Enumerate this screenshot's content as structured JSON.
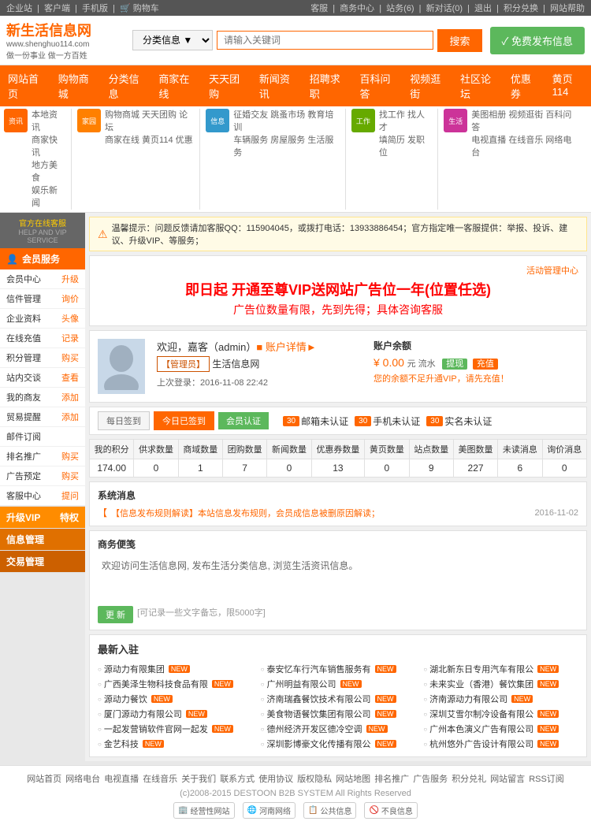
{
  "topbar": {
    "left_links": [
      "企业站",
      "客户端",
      "手机版",
      "购物车"
    ],
    "right_links": [
      "客服",
      "商务中心",
      "站务(6)",
      "新对话(0)",
      "退出",
      "积分兑换",
      "网站帮助"
    ]
  },
  "header": {
    "logo_name": "新生活信息网",
    "logo_url": "www.shenghuo114.com",
    "logo_slogan": "做一份事业 做一方百姓",
    "search_placeholder": "请输入关键词",
    "search_category": "分类信息",
    "search_btn": "搜索",
    "publish_btn": "✓ 免费发布信息"
  },
  "main_nav": {
    "items": [
      {
        "label": "网站首页",
        "active": false
      },
      {
        "label": "购物商城",
        "active": false
      },
      {
        "label": "分类信息",
        "active": false
      },
      {
        "label": "商家在线",
        "active": false
      },
      {
        "label": "天天团购",
        "active": false
      },
      {
        "label": "新闻资讯",
        "active": false
      },
      {
        "label": "招聘求职",
        "active": false
      },
      {
        "label": "百科问答",
        "active": false
      },
      {
        "label": "视频逛街",
        "active": false
      },
      {
        "label": "社区论坛",
        "active": false
      },
      {
        "label": "优惠券",
        "active": false
      },
      {
        "label": "黄页114",
        "active": false
      }
    ]
  },
  "sub_nav": {
    "sections": [
      {
        "icon": "资讯",
        "color": "#ff6600",
        "links": [
          "本地资讯",
          "商家快讯",
          "地方美食",
          "娱乐新闻"
        ]
      },
      {
        "icon": "家园",
        "color": "#ff8000",
        "links": [
          "购物商城",
          "天天团购",
          "论坛",
          "商家在线",
          "黄页114",
          "优惠"
        ]
      },
      {
        "icon": "信息",
        "color": "#3399cc",
        "links": [
          "征婚交友",
          "跳蚤市场",
          "教育培训",
          "车辆服务",
          "房屋服务",
          "生活服务"
        ]
      },
      {
        "icon": "工作",
        "color": "#66aa00",
        "links": [
          "找工作",
          "找人才",
          "填简历",
          "发职位"
        ]
      },
      {
        "icon": "生活",
        "color": "#cc3399",
        "links": [
          "美图相册",
          "视频逛街",
          "百科问答",
          "电视直播",
          "在线音乐",
          "网络电台"
        ]
      }
    ]
  },
  "sidebar": {
    "customer_service": {
      "title": "官方在线客服",
      "sub": "HELP AND VIP SERVICE"
    },
    "member_section": {
      "title": "会员服务"
    },
    "items": [
      {
        "left": "会员中心",
        "right": "升级"
      },
      {
        "left": "信件管理",
        "right": "询价"
      },
      {
        "left": "企业资料",
        "right": "头像"
      },
      {
        "left": "在线充值",
        "right": "记录"
      },
      {
        "left": "积分管理",
        "right": "购买"
      },
      {
        "left": "站内交谈",
        "right": "查看"
      },
      {
        "left": "我的商友",
        "right": "添加"
      },
      {
        "left": "贸易提醒",
        "right": "添加"
      },
      {
        "left": "邮件订阅",
        "right": ""
      },
      {
        "left": "排名推广",
        "right": "购买"
      },
      {
        "left": "广告预定",
        "right": "购买"
      },
      {
        "left": "客服中心",
        "right": "提问"
      }
    ],
    "vip_section": {
      "title": "升级VIP",
      "right": "特权"
    },
    "info_section": {
      "title": "信息管理"
    },
    "trade_section": {
      "title": "交易管理"
    }
  },
  "alert": {
    "text": "温馨提示：问题反馈请加客服QQ：115904045，或拨打电话：13933886454；官方指定唯一客服提供：举报、投诉、建议、升级VIP、等服务；"
  },
  "vip_promo": {
    "title": "即日起 开通至尊VIP送网站广告位一年(位置任选)",
    "sub": "广告位数量有限，先到先得；具体咨询客服"
  },
  "user_panel": {
    "welcome": "欢迎，嘉客（admin）",
    "profile_link": "账户详情►",
    "role": "【管理员】",
    "site": "生活信息网",
    "last_login": "上次登录：2016-11-08 22:42",
    "account_title": "账户余额",
    "balance": "¥ 0.00",
    "balance_unit": "元 流水",
    "withdraw_btn": "提现",
    "recharge_btn": "充值",
    "vip_warning": "您的余额不足升通VIP，请先充值！"
  },
  "daily": {
    "checkin_label": "每日签到",
    "today_label": "今日已签到",
    "auth_label": "会员认证",
    "email_badge": "30",
    "phone_badge": "30",
    "real_badge": "30",
    "email_label": "邮箱未认证",
    "phone_label": "手机未认证",
    "real_label": "实名未认证"
  },
  "stats": {
    "headers": [
      "我的积分",
      "供求数量",
      "商域数量",
      "团购数量",
      "新闻数量",
      "优惠券数量",
      "黄页数量",
      "站点数量",
      "美图数量",
      "未读消息",
      "询价消息"
    ],
    "values": [
      "174.00",
      "0",
      "1",
      "7",
      "0",
      "13",
      "0",
      "9",
      "227",
      "6",
      "0"
    ]
  },
  "sys_msg": {
    "title": "系统消息",
    "item_text": "【信息发布规则解读】本站信息发布规则，会员成信息被删原因解读；",
    "date": "2016-11-02"
  },
  "notepad": {
    "title": "商务便笺",
    "content": "欢迎访问生活信息网, 发布生活分类信息, 浏览生活资讯信息。",
    "save_btn": "更 新",
    "hint": "[可记录一些文字备忘，限5000字]"
  },
  "latest": {
    "title": "最新入驻",
    "items": [
      {
        "name": "源动力有限集团",
        "new": true
      },
      {
        "name": "泰安忆车行汽车销售服务有",
        "new": true
      },
      {
        "name": "湖北新东日专用汽车有限公",
        "new": true
      },
      {
        "name": "广西美泽生物科技食品有限",
        "new": true
      },
      {
        "name": "广州明益有限公司",
        "new": true
      },
      {
        "name": "未来实业（香港）餐饮集团",
        "new": true
      },
      {
        "name": "源动力餐饮",
        "new": true
      },
      {
        "name": "济南瑞鑫餐饮技术有限公司",
        "new": true
      },
      {
        "name": "济南源动力有限公司",
        "new": true
      },
      {
        "name": "厦门源动力有限公司",
        "new": true
      },
      {
        "name": "美食物语餐饮集团有限公司",
        "new": true
      },
      {
        "name": "深圳艾雪尔制冷设备有限公",
        "new": true
      },
      {
        "name": "一起发营销软件官网一起发",
        "new": true
      },
      {
        "name": "德州经济开发区德冷空调",
        "new": true
      },
      {
        "name": "广州本色演义广告有限公司",
        "new": true
      },
      {
        "name": "金艺科技",
        "new": true
      },
      {
        "name": "深圳影博豪文化传播有限公",
        "new": true
      },
      {
        "name": "杭州悠外广告设计有限公司",
        "new": true
      }
    ]
  },
  "footer": {
    "links": [
      "网站首页",
      "网络电台",
      "电视直播",
      "在线音乐",
      "关于我们",
      "联系方式",
      "使用协议",
      "版权隐私",
      "网站地图",
      "排名推广",
      "广告服务",
      "积分兑礼",
      "网站留言",
      "RSS订阅"
    ],
    "copyright": "(c)2008-2015 DESTOON B2B SYSTEM All Rights Reserved",
    "logos": [
      "经营性网站",
      "河南网络",
      "公共信息",
      "不良信息"
    ]
  }
}
